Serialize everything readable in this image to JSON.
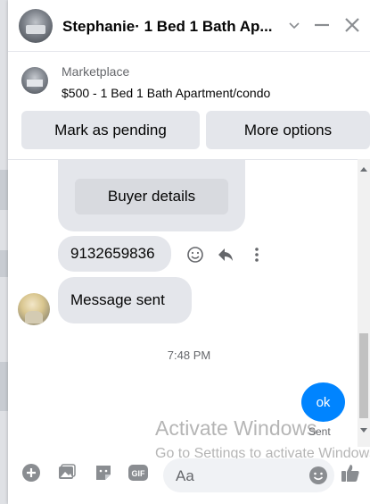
{
  "header": {
    "title": "Stephanie· 1 Bed 1 Bath Ap...",
    "icons": [
      "chevron-down-icon",
      "minimize-icon",
      "close-icon"
    ]
  },
  "product": {
    "source": "Marketplace",
    "listing": "$500 - 1 Bed 1 Bath Apartment/condo"
  },
  "actions": {
    "mark_pending": "Mark as pending",
    "more_options": "More options"
  },
  "messages": {
    "buyer_details": "Buyer details",
    "phone": "9132659836",
    "message_sent": "Message sent",
    "time": "7:48 PM",
    "ok": "ok",
    "status": "Sent"
  },
  "watermark": {
    "line1": "Activate Windows",
    "line2": "Go to Settings to activate Windows."
  },
  "composer": {
    "placeholder": "Aa",
    "icons": [
      "plus-icon",
      "image-icon",
      "sticker-icon",
      "gif-icon",
      "emoji-icon",
      "thumbs-up-icon"
    ],
    "gif_label": "GIF"
  },
  "colors": {
    "accent": "#0084ff",
    "bubble": "#e4e6eb",
    "icon": "#8a8d91"
  }
}
